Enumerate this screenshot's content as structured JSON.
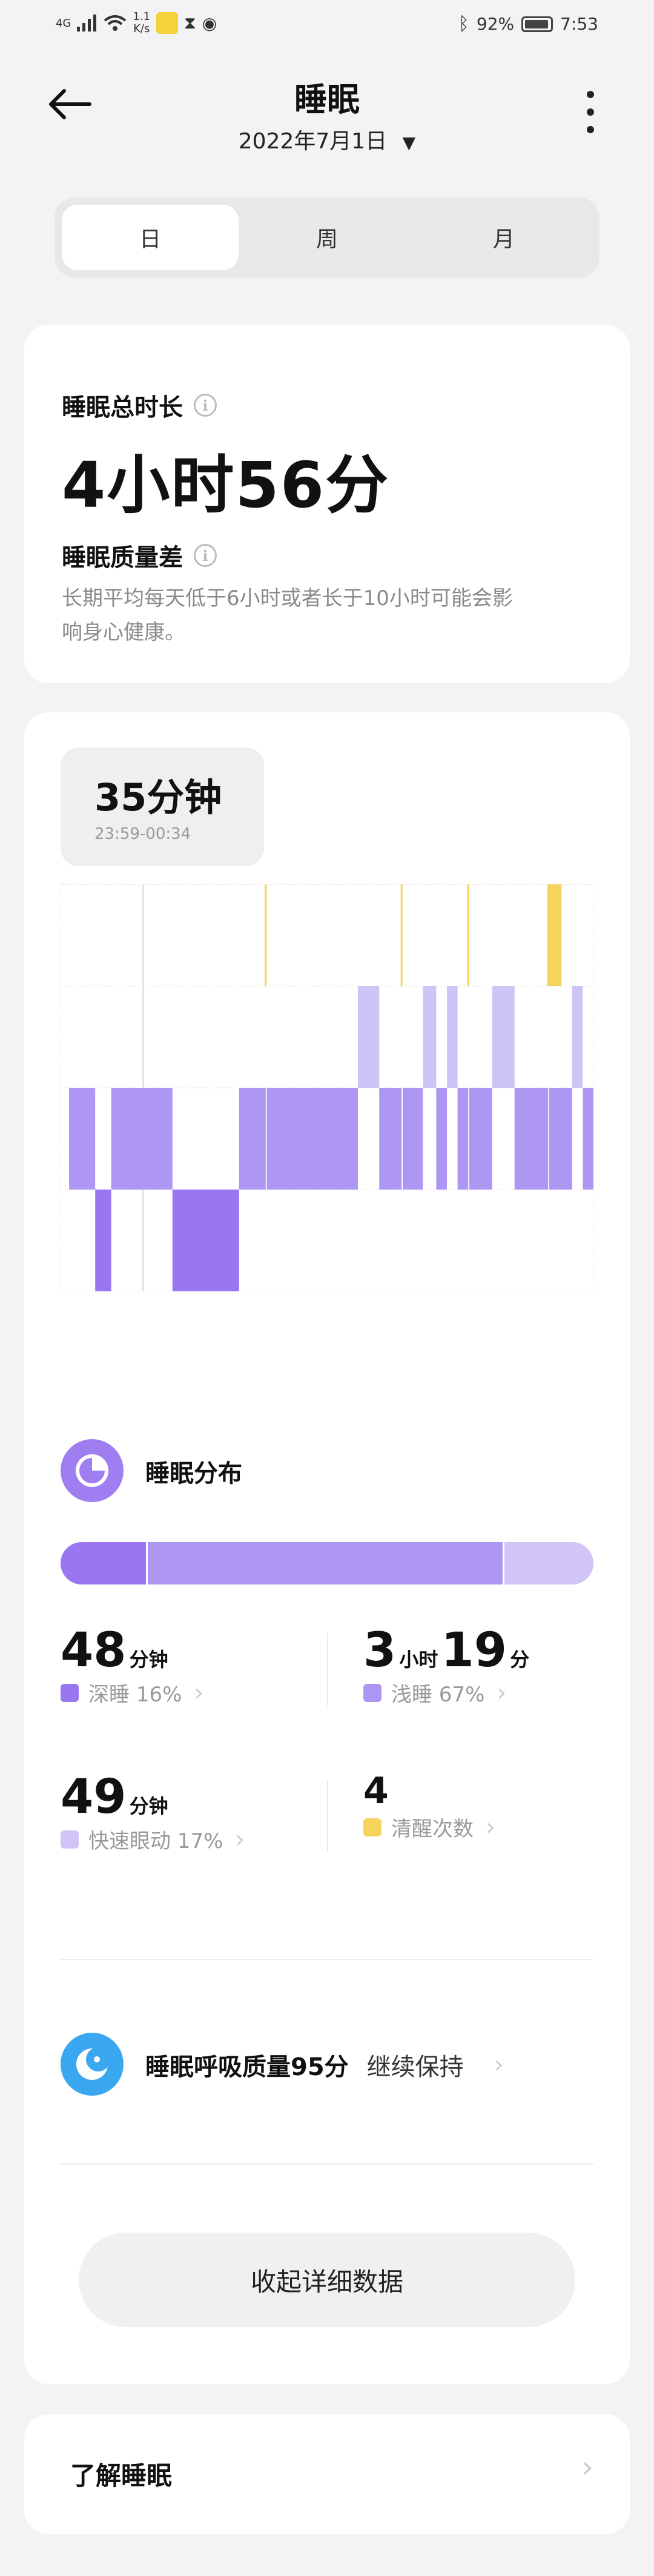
{
  "status_bar": {
    "signal": "4G",
    "speed_value": "1.1",
    "speed_unit": "K/s",
    "battery": "92%",
    "time": "7:53"
  },
  "header": {
    "title": "睡眠",
    "date": "2022年7月1日"
  },
  "tabs": [
    {
      "label": "日",
      "active": true
    },
    {
      "label": "周",
      "active": false
    },
    {
      "label": "月",
      "active": false
    }
  ],
  "summary": {
    "total_label": "睡眠总时长",
    "total_value": "4小时56分",
    "quality_label": "睡眠质量差",
    "quality_desc_line1": "长期平均每天低于6小时或者长于10小时可能会影",
    "quality_desc_line2": "响身心健康。"
  },
  "tooltip": {
    "duration": "35分钟",
    "range": "23:59-00:34"
  },
  "chart_data": {
    "type": "sleep-stage-timeline",
    "x_start": "23:34",
    "x_end": "04:42",
    "levels": [
      "清醒",
      "快速眼动",
      "浅睡",
      "深睡"
    ],
    "colors": {
      "awake": "#f6d35b",
      "rem": "#cfc4f6",
      "light": "#ad97f3",
      "deep": "#9a77f1"
    },
    "segments": [
      {
        "stage": "light",
        "start": 0.016,
        "end": 0.065
      },
      {
        "stage": "deep",
        "start": 0.065,
        "end": 0.095
      },
      {
        "stage": "light",
        "start": 0.095,
        "end": 0.21
      },
      {
        "stage": "deep",
        "start": 0.21,
        "end": 0.335
      },
      {
        "stage": "light",
        "start": 0.335,
        "end": 0.385
      },
      {
        "stage": "light",
        "start": 0.387,
        "end": 0.558
      },
      {
        "stage": "rem",
        "start": 0.558,
        "end": 0.598
      },
      {
        "stage": "light",
        "start": 0.598,
        "end": 0.64
      },
      {
        "stage": "light",
        "start": 0.642,
        "end": 0.68
      },
      {
        "stage": "rem",
        "start": 0.68,
        "end": 0.705
      },
      {
        "stage": "light",
        "start": 0.705,
        "end": 0.725
      },
      {
        "stage": "rem",
        "start": 0.725,
        "end": 0.745
      },
      {
        "stage": "light",
        "start": 0.745,
        "end": 0.765
      },
      {
        "stage": "light",
        "start": 0.767,
        "end": 0.81
      },
      {
        "stage": "rem",
        "start": 0.81,
        "end": 0.852
      },
      {
        "stage": "light",
        "start": 0.852,
        "end": 0.915
      },
      {
        "stage": "light",
        "start": 0.917,
        "end": 0.96
      },
      {
        "stage": "rem",
        "start": 0.96,
        "end": 0.98
      },
      {
        "stage": "light",
        "start": 0.98,
        "end": 1.0
      }
    ],
    "awake_marks": [
      0.385,
      0.64,
      0.765,
      0.915
    ],
    "awake_block": {
      "start": 0.915,
      "end": 0.94
    },
    "cursor": 0.155
  },
  "distribution": {
    "title": "睡眠分布",
    "bar": [
      {
        "fraction": 0.16,
        "color": "#9a77f1"
      },
      {
        "fraction": 0.67,
        "color": "#ad97f3"
      },
      {
        "fraction": 0.17,
        "color": "#d0c5f6"
      }
    ],
    "deep": {
      "num": "48",
      "unit": "分钟",
      "label": "深睡 16%",
      "color": "#9a77f1"
    },
    "light": {
      "num1": "3",
      "unit1": "小时",
      "num2": "19",
      "unit2": "分",
      "label": "浅睡 67%",
      "color": "#ad97f3"
    },
    "rem": {
      "num": "49",
      "unit": "分钟",
      "label": "快速眼动 17%",
      "color": "#d0c5f6"
    },
    "awake": {
      "num": "4",
      "label": "清醒次数",
      "color": "#f6d35b"
    }
  },
  "breathing": {
    "title": "睡眠呼吸质量95分",
    "status": "继续保持"
  },
  "collapse_button": "收起详细数据",
  "learn_more": "了解睡眠"
}
